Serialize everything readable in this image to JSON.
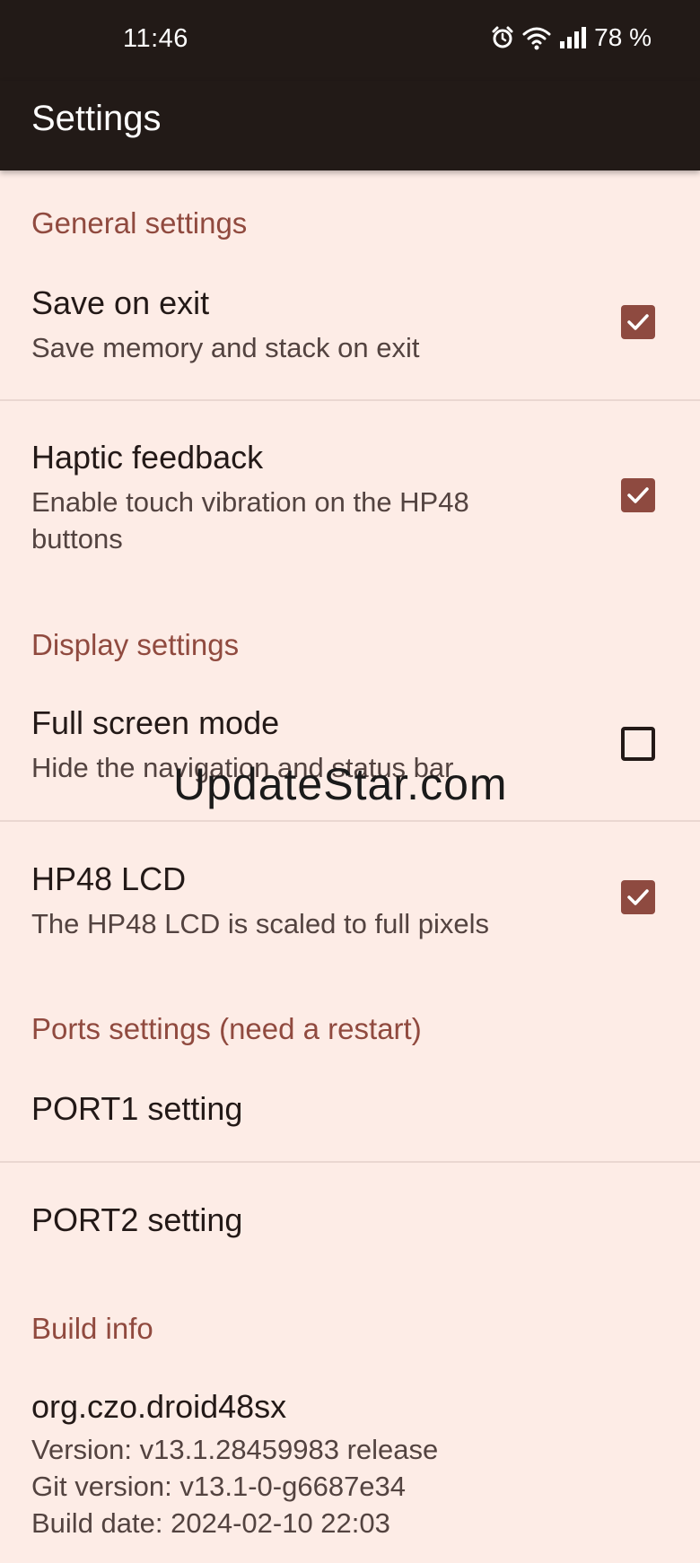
{
  "status_bar": {
    "time": "11:46",
    "battery": "78 %",
    "icons": [
      "alarm-icon",
      "wifi-icon",
      "signal-icon"
    ]
  },
  "app_bar": {
    "title": "Settings"
  },
  "sections": {
    "general": {
      "header": "General settings",
      "save_on_exit": {
        "title": "Save on exit",
        "summary": "Save memory and stack on exit",
        "checked": true
      },
      "haptic": {
        "title": "Haptic feedback",
        "summary": "Enable touch vibration on the HP48 buttons",
        "checked": true
      }
    },
    "display": {
      "header": "Display settings",
      "full_screen": {
        "title": "Full screen mode",
        "summary": "Hide the navigation and status bar",
        "checked": false
      },
      "hp48_lcd": {
        "title": "HP48 LCD",
        "summary": "The HP48 LCD is scaled to full pixels",
        "checked": true
      }
    },
    "ports": {
      "header": "Ports settings (need a restart)",
      "port1": {
        "title": "PORT1 setting"
      },
      "port2": {
        "title": "PORT2 setting"
      }
    },
    "build": {
      "header": "Build info",
      "package": "org.czo.droid48sx",
      "version": "Version: v13.1.28459983 release",
      "git_version": "Git version: v13.1-0-g6687e34",
      "build_date": "Build date: 2024-02-10 22:03"
    }
  },
  "watermark": "UpdateStar.com",
  "colors": {
    "background": "#fdece6",
    "bar": "#221a17",
    "accent": "#904a3f",
    "checkbox": "#8e4a40"
  }
}
